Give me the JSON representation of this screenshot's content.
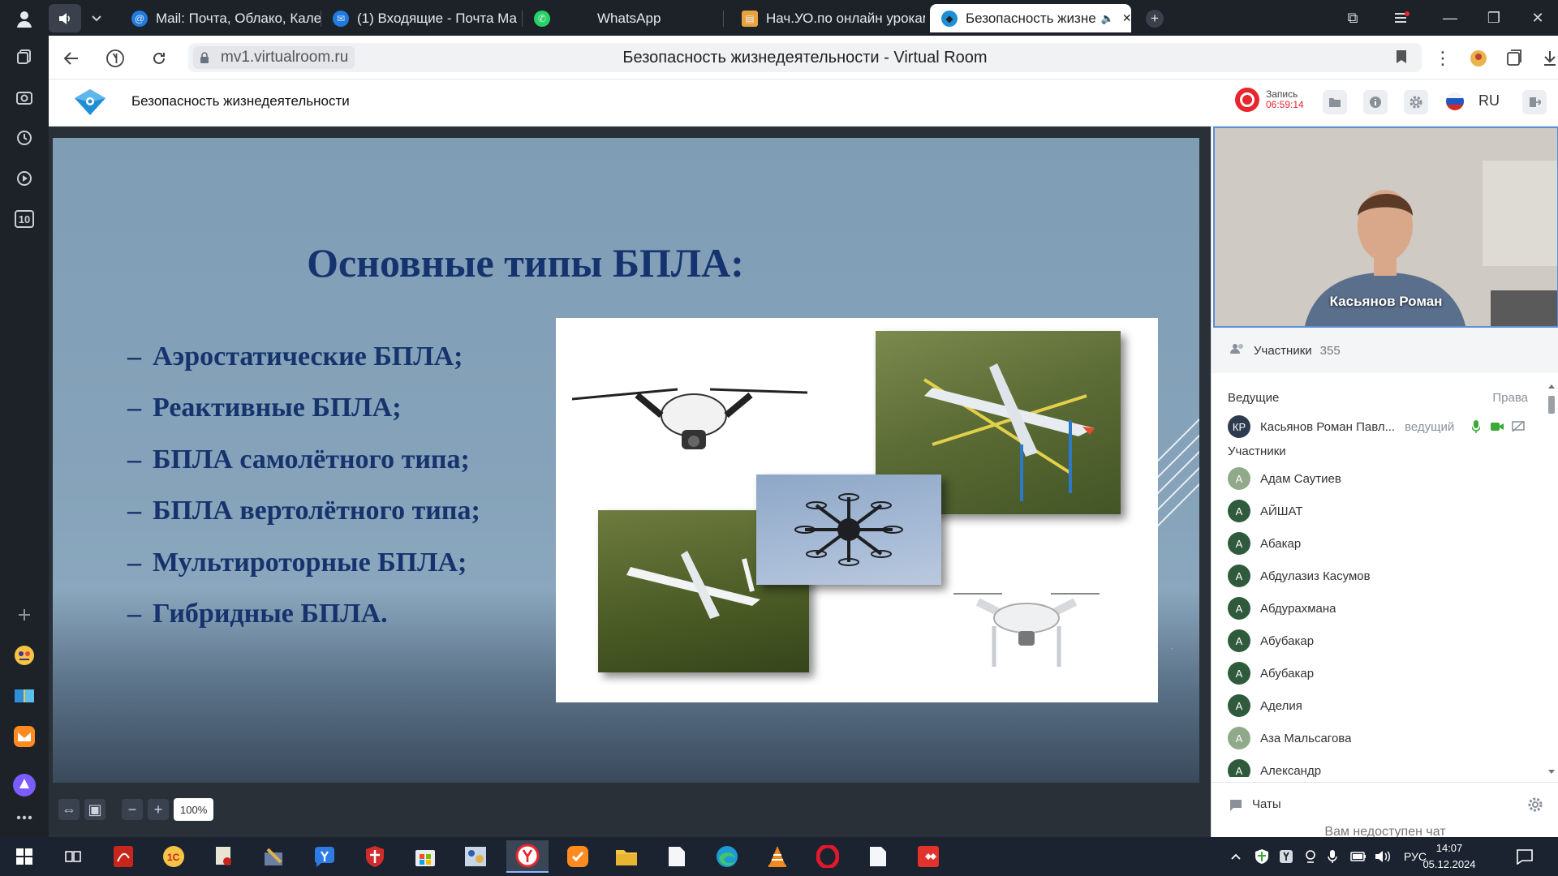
{
  "browser": {
    "tabs": [
      {
        "title": "",
        "icon": "speaker-icon"
      },
      {
        "title": "Mail: Почта, Облако, Кале",
        "icon": "mail-at-icon"
      },
      {
        "title": "(1) Входящие - Почта Ма",
        "icon": "mail-envelope-icon"
      },
      {
        "title": "WhatsApp",
        "icon": "whatsapp-icon"
      },
      {
        "title": "Нач.УО.по онлайн урокам",
        "icon": "document-icon"
      },
      {
        "title": "Безопасность жизне",
        "icon": "virtualroom-icon",
        "active": true
      }
    ],
    "url_host": "mv1.virtualroom.ru",
    "page_title": "Безопасность жизнедеятельности - Virtual Room",
    "side_panel": {
      "badge": "10"
    }
  },
  "app": {
    "title": "Безопасность жизнедеятельности",
    "recording": {
      "label": "Запись",
      "time": "06:59:14",
      "color": "#e8262d"
    },
    "language": "RU"
  },
  "slide": {
    "title": "Основные типы БПЛА:",
    "items": [
      {
        "dash": "–",
        "text": "Аэростатические БПЛА;"
      },
      {
        "dash": "–",
        "text": "Реактивные БПЛА;"
      },
      {
        "dash": "–",
        "text": "БПЛА самолётного типа;"
      },
      {
        "dash": "–",
        "text": "БПЛА вертолётного типа;"
      },
      {
        "dash": "–",
        "text": "Мультироторные БПЛА;"
      },
      {
        "dash": "–",
        "text": "Гибридные БПЛА."
      }
    ],
    "zoom": "100%"
  },
  "video": {
    "name": "Касьянов Роман"
  },
  "participants": {
    "label": "Участники",
    "count": "355",
    "hosts_label": "Ведущие",
    "rights_label": "Права",
    "host": {
      "initials": "КР",
      "name": "Касьянов Роман Павл...",
      "role": "ведущий"
    },
    "section_label": "Участники",
    "list": [
      {
        "initial": "А",
        "name": "Адам Саутиев",
        "color": "#8fa98a"
      },
      {
        "initial": "А",
        "name": "АЙШАТ",
        "color": "#2f5a3c"
      },
      {
        "initial": "А",
        "name": "Абакар",
        "color": "#2f5a3c"
      },
      {
        "initial": "А",
        "name": "Абдулазиз Касумов",
        "color": "#2f5a3c"
      },
      {
        "initial": "А",
        "name": "Абдурахмана",
        "color": "#2f5a3c"
      },
      {
        "initial": "А",
        "name": "Абубакар",
        "color": "#2f5a3c"
      },
      {
        "initial": "А",
        "name": "Абубакар",
        "color": "#2f5a3c"
      },
      {
        "initial": "А",
        "name": "Аделия",
        "color": "#2f5a3c"
      },
      {
        "initial": "А",
        "name": "Аза Мальсагова",
        "color": "#8fa98a"
      },
      {
        "initial": "А",
        "name": "Александр",
        "color": "#2f5a3c"
      }
    ]
  },
  "chat": {
    "label": "Чаты",
    "note": "Вам недоступен чат"
  },
  "taskbar": {
    "tray_lang": "РУС",
    "time": "14:07",
    "date": "05.12.2024"
  }
}
